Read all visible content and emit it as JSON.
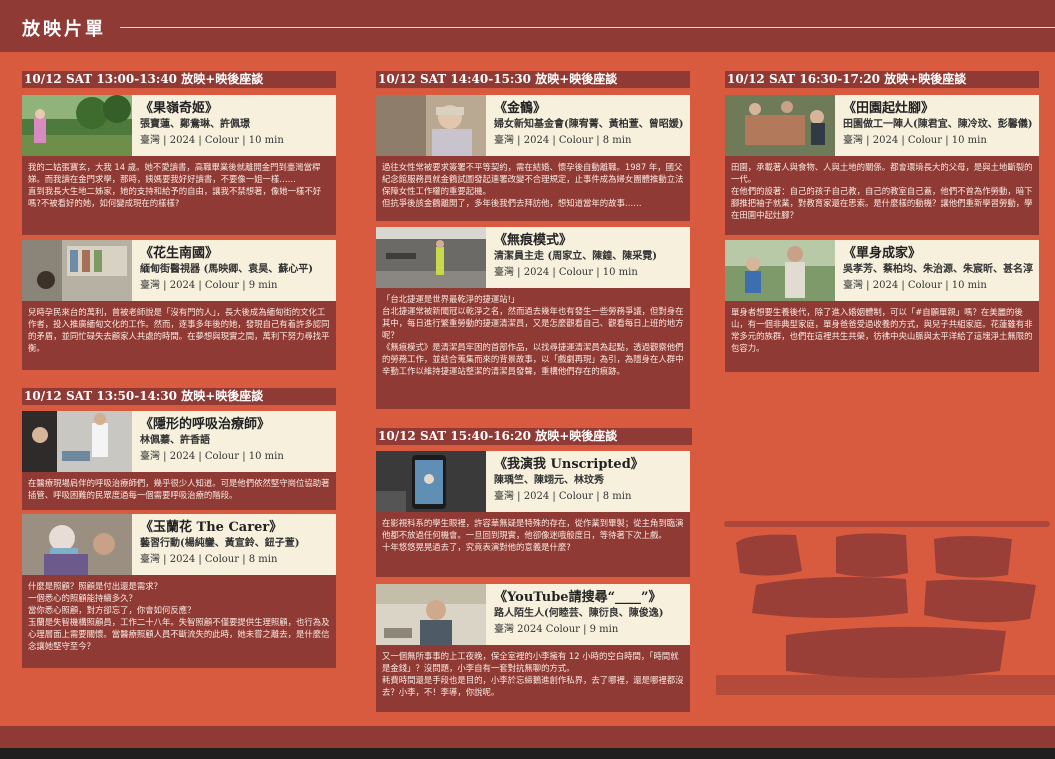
{
  "header": {
    "title": "放映片單"
  },
  "columns": [
    {
      "label": "10/12 SAT 13:00-13:40 放映+映後座談"
    },
    {
      "label": "10/12 SAT 13:50-14:30 放映+映後座談"
    },
    {
      "label": "10/12 SAT 14:40-15:30 放映+映後座談"
    },
    {
      "label": "10/12 SAT 15:40-16:20 放映+映後座談"
    },
    {
      "label": "10/12 SAT 16:30-17:20 放映+映後座談"
    }
  ],
  "films": [
    {
      "title": "《果嶺奇姬》",
      "credit": "張寶蓮、鄭鴦琳、許佩璟",
      "meta": "臺灣 | 2024 | Colour | 10 min",
      "desc": [
        "我的二姑張寶玄，大我 14 歲。她不愛讀書，高職畢業後就離開金門到臺灣當桿娣。而我讀在金門求學，那時，姨媽要我好好讀書，不要像一姐一樣……",
        "直到我長大生地二姊家，她的支持和給予的自由，讓我不禁想著，像她一樣不好嗎?不被看好的她，如何變成現在的樣樣?"
      ]
    },
    {
      "title": "《花生南國》",
      "credit": "緬甸街醫視器 (馬映卿、袁昊、蘇心平)",
      "meta": "臺灣 | 2024 | Colour | 9 min",
      "desc": [
        "兒時孕民來台的萬利，曾被老師說是「沒有門的人」，長大後成為緬甸街的文化工作者，投入推廣緬甸文化的工作。然而，逐事多年後的她，發現自己有着許多認同的矛盾，並同忙碌失去顧家人共處的時間。在夢想與現實之間，萬利下努力尋找平衡。"
      ]
    },
    {
      "title": "《隱形的呼吸治療師》",
      "credit": "林佩蓁、許香語",
      "meta": "臺灣 | 2024 | Colour | 10 min",
      "desc": [
        "在醫療現場肩伴的呼吸治療師們，幾乎很少人知道。可是他們依然堅守崗位協助著插管、呼吸困難的民眾度過每一個需要呼吸治療的階段。"
      ]
    },
    {
      "title": "《玉蘭花 The Carer》",
      "credit": "藝習行動(楊純鑾、黃宣鈴、鈕子萱)",
      "meta": "臺灣 | 2024 | Colour | 8 min",
      "desc": [
        "什麼是照顧？照顧是付出還是需求？",
        "一個悉心的照顧能持續多久？",
        "當你悉心照顧，對方卻忘了，你會如何反應？",
        "玉蘭是失智機構照顧員，工作二十八年。失智照顧不僅要提供生理照顧，也行為及心理層面上需要關懷。當醫療照顧人員不斷流失的此時，她未嘗之離去，是什麼信念讓她堅守至今？"
      ]
    },
    {
      "title": "《金鶴》",
      "credit": "婦女新知基金會(陳宥菁、黃柏萱、曾昭媛)",
      "meta": "臺灣 | 2024 | Colour | 8 min",
      "desc": [
        "過往女性常被要求簽署不平等契約，需在結婚、懷孕後自動離職。1987 年，國父紀念館服務員就金鶴試圖發起連署改變不合理規定，止事件成為婦女團體推動立法保障女性工作權的重要起機。",
        "但抗爭後該金鶴離開了，多年後我們去拜訪他，想知道當年的故事……"
      ]
    },
    {
      "title": "《無痕模式》",
      "credit": "清潔員主走 (周家立、陳鍠、陳采霓)",
      "meta": "臺灣 | 2024 | Colour | 10 min",
      "desc": [
        "「台北捷運是世界最乾淨的捷運站!」",
        "台北捷運常被新聞冠以乾淨之名，然而過去幾年也有發生一些勞務爭議，但對身在其中，每日進行繁重勞動的捷運清潔員，又是怎麼觀看自己、觀看每日上班的地方呢？",
        "《無痕模式》是清潔員牢困的首部作品，以找尋捷運清潔員為起點，透過觀察他們的勞務工作，並結合蒐集而來的背景故事，以「戲劇再現」為引，為隱身在人群中辛勤工作以維持捷運站整潔的清潔員發聲，重構他們存在的痕跡。"
      ]
    },
    {
      "title": "《我演我 Unscripted》",
      "credit": "陳瑀竺、陳翊元、林玟秀",
      "meta": "臺灣 | 2024 | Colour | 8 min",
      "desc": [
        "在影視科系的學生眼裡，許容華無疑是特殊的存在，從作業到畢製；從主角到臨演他都不放過任何機會。一旦回到現實，他卻像迷哦般度日，等待著下次上戲。",
        "十年悠悠晃晃過去了，究竟表演對他的意義是什麼?"
      ]
    },
    {
      "title": "《YouTube請搜尋“____”》",
      "credit": "路人陌生人(何睦芸、陳衍良、陳俊逸)",
      "meta": "臺灣 2024 Colour | 9 min",
      "desc": [
        "又一個無所事事的上工夜晚，保全室裡的小李擁有 12 小時的空白時間，「時間就是金錢」？沒問題，小李自有一套對抗無聊的方式。",
        "耗費時間還是手段也是目的，小李於忘締鵝進創作私界，去了哪裡，還是哪裡都沒去？小李，不！李導，你說呢。"
      ]
    },
    {
      "title": "《田園起灶腳》",
      "credit": "田園做工一陣人(陳君宜、陳冷玟、彭馨儀)",
      "meta": "臺灣 | 2024 | Colour | 10 min",
      "desc": [
        "田園，承載著人與食物、人與土地的關係。都會環境長大的父母，是與土地斷裂的一代。",
        "在他們的設著：自己的孩子自己教，自己的教室自己蓋，他們不曾為作勞動，暗下腳推把袖子就業，對教育家還在思索。是什麼樣的動機？讓他們重新學習勞動，學在田園中起灶腳？"
      ]
    },
    {
      "title": "《單身成家》",
      "credit": "吳孝芳、蔡柏均、朱治源、朱宸昕、甚名淳",
      "meta": "臺灣 | 2024 | Colour | 10 min",
      "desc": [
        "單身者想要生養後代，除了進入婚姻體制，可以「#自願單親」嗎？在美麗的後山，有一個非典型家庭，單身爸爸受過收養的方式，與兒子共組家庭。花蓮雖有非常多元的族群，也們在這裡共生共榮，彷彿中央山脈與太平洋給了這塊淨土無限的包容力。"
      ]
    }
  ]
}
